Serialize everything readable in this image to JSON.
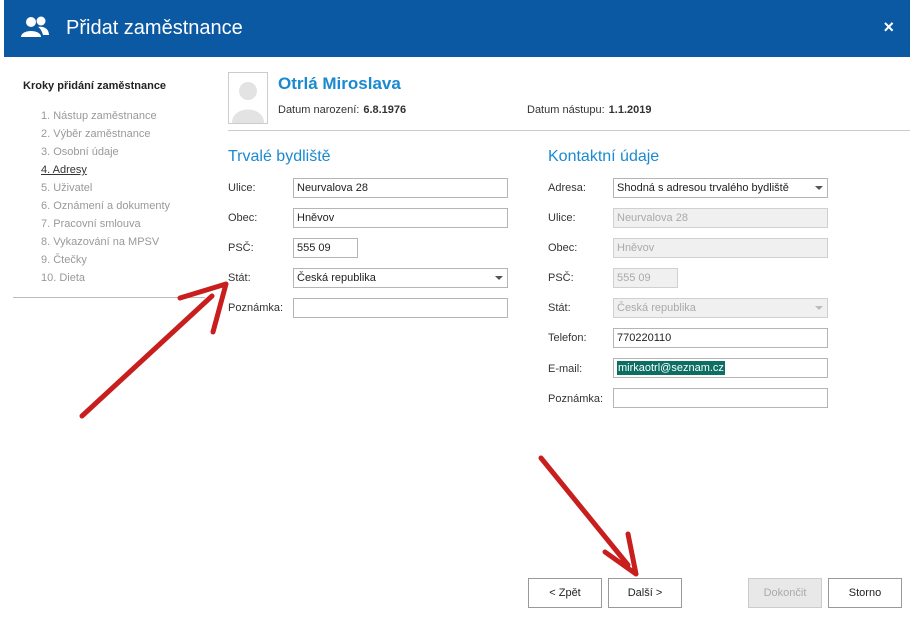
{
  "window": {
    "title": "Přidat zaměstnance",
    "close": "×"
  },
  "sidebar": {
    "heading": "Kroky přidání zaměstnance",
    "steps": [
      "1. Nástup zaměstnance",
      "2. Výběr zaměstnance",
      "3. Osobní údaje",
      "4. Adresy",
      "5. Uživatel",
      "6. Oznámení a dokumenty",
      "7. Pracovní smlouva",
      "8. Vykazování na MPSV",
      "9. Čtečky",
      "10. Dieta"
    ],
    "active_index": 3
  },
  "employee": {
    "name": "Otrlá Miroslava",
    "birth_label": "Datum narození:",
    "birth_value": "6.8.1976",
    "start_label": "Datum nástupu:",
    "start_value": "1.1.2019"
  },
  "residence": {
    "title": "Trvalé bydliště",
    "street_label": "Ulice:",
    "street": "Neurvalova 28",
    "city_label": "Obec:",
    "city": "Hněvov",
    "zip_label": "PSČ:",
    "zip": "555 09",
    "country_label": "Stát:",
    "country": "Česká republika",
    "note_label": "Poznámka:",
    "note": ""
  },
  "contact": {
    "title": "Kontaktní údaje",
    "address_label": "Adresa:",
    "address": "Shodná s adresou trvalého bydliště",
    "street_label": "Ulice:",
    "street": "Neurvalova 28",
    "city_label": "Obec:",
    "city": "Hněvov",
    "zip_label": "PSČ:",
    "zip": "555 09",
    "country_label": "Stát:",
    "country": "Česká republika",
    "phone_label": "Telefon:",
    "phone": "770220110",
    "email_label": "E-mail:",
    "email": "mirkaotrl@seznam.cz",
    "note_label": "Poznámka:",
    "note": ""
  },
  "buttons": {
    "back": "< Zpět",
    "next": "Další >",
    "finish": "Dokončit",
    "cancel": "Storno"
  },
  "colors": {
    "titlebar": "#0b58a3",
    "accent": "#1a8ad0",
    "arrow": "#d42020",
    "selection": "#0d6e64"
  }
}
